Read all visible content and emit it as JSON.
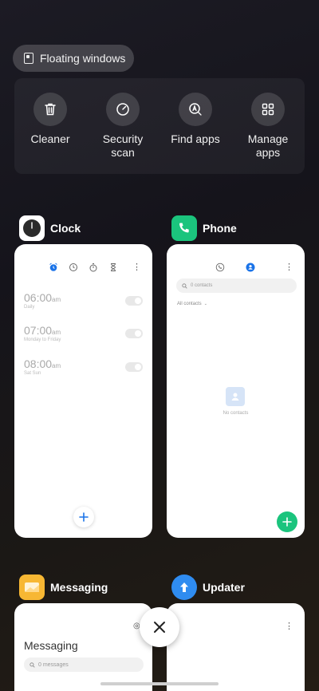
{
  "floating": {
    "label": "Floating windows"
  },
  "quick_actions": [
    {
      "label": "Cleaner",
      "icon": "trash-icon"
    },
    {
      "label": "Security\nscan",
      "icon": "gauge-icon"
    },
    {
      "label": "Find apps",
      "icon": "find-apps-icon"
    },
    {
      "label": "Manage\napps",
      "icon": "grid-icon"
    }
  ],
  "apps": {
    "clock": {
      "name": "Clock",
      "alarms": [
        {
          "time": "06:00",
          "ampm": "am",
          "sub": "Daily"
        },
        {
          "time": "07:00",
          "ampm": "am",
          "sub": "Monday to Friday"
        },
        {
          "time": "08:00",
          "ampm": "am",
          "sub": "Sat Sun"
        }
      ]
    },
    "phone": {
      "name": "Phone",
      "search_placeholder": "0 contacts",
      "filter": "All contacts",
      "empty_text": "No contacts"
    },
    "messaging": {
      "name": "Messaging",
      "title": "Messaging",
      "search_placeholder": "0 messages"
    },
    "updater": {
      "name": "Updater"
    }
  },
  "colors": {
    "clock_accent": "#1a73e8",
    "phone_green": "#1bc47d",
    "messaging_yellow": "#f7b733",
    "updater_blue": "#2f8cf0"
  }
}
